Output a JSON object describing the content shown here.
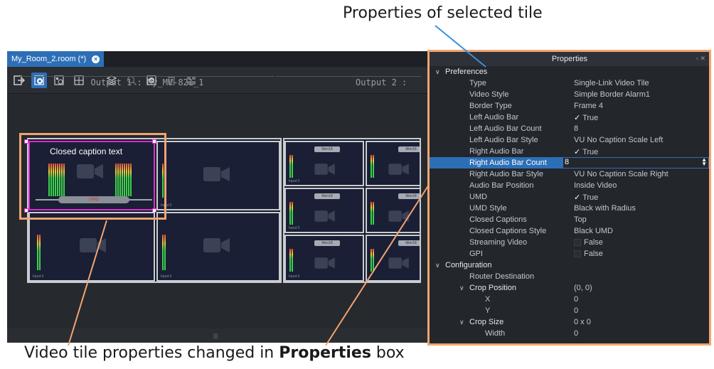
{
  "callouts": {
    "top": "Properties of selected tile",
    "bottom_pre": "Video tile properties changed in ",
    "bottom_bold": "Properties",
    "bottom_post": " box"
  },
  "editor": {
    "tab_label": "My_Room_2.room (*)",
    "toolbar_icons": [
      "exit-icon",
      "add-tile-icon",
      "add-router-icon",
      "grid-icon",
      "layers-icon",
      "zoom-icon",
      "add-icon",
      "delete-icon",
      "layout-icon"
    ],
    "output1_title": "Output 1 : My_MV-821_1",
    "output2_title": "Output 2 :",
    "selected_tile": {
      "caption": "Closed caption text",
      "umd": "UMD"
    },
    "tile_input_label": "Input 0",
    "monitor_label": "Mon18",
    "scroll_grip": "|||"
  },
  "properties": {
    "title": "Properties",
    "rows": [
      {
        "key": "Preferences",
        "value": "",
        "group": true,
        "indent": 0
      },
      {
        "key": "Type",
        "value": "Single-Link Video Tile",
        "indent": 1
      },
      {
        "key": "Video Style",
        "value": "Simple Border Alarm1",
        "indent": 1
      },
      {
        "key": "Border Type",
        "value": "Frame 4",
        "indent": 1
      },
      {
        "key": "Left Audio Bar",
        "value": "True",
        "check": "on",
        "indent": 1
      },
      {
        "key": "Left Audio Bar Count",
        "value": "8",
        "indent": 1
      },
      {
        "key": "Left Audio Bar Style",
        "value": "VU No Caption Scale Left",
        "indent": 1
      },
      {
        "key": "Right Audio Bar",
        "value": "True",
        "check": "on",
        "indent": 1
      },
      {
        "key": "Right Audio Bar Count",
        "value": "8",
        "selected": true,
        "indent": 1
      },
      {
        "key": "Right Audio Bar Style",
        "value": "VU No Caption Scale Right",
        "indent": 1
      },
      {
        "key": "Audio Bar Position",
        "value": "Inside Video",
        "indent": 1
      },
      {
        "key": "UMD",
        "value": "True",
        "check": "on",
        "indent": 1
      },
      {
        "key": "UMD Style",
        "value": "Black with Radius",
        "indent": 1
      },
      {
        "key": "Closed Captions",
        "value": "Top",
        "indent": 1
      },
      {
        "key": "Closed Captions Style",
        "value": "Black UMD",
        "indent": 1
      },
      {
        "key": "Streaming Video",
        "value": "False",
        "check": "off",
        "indent": 1
      },
      {
        "key": "GPI",
        "value": "False",
        "check": "off",
        "indent": 1
      },
      {
        "key": "Configuration",
        "value": "",
        "group": true,
        "indent": 0
      },
      {
        "key": "Router Destination",
        "value": "",
        "indent": 1
      },
      {
        "key": "Crop Position",
        "value": "(0, 0)",
        "group": true,
        "indent": 1
      },
      {
        "key": "X",
        "value": "0",
        "indent": 2
      },
      {
        "key": "Y",
        "value": "0",
        "indent": 2
      },
      {
        "key": "Crop Size",
        "value": "0 x 0",
        "group": true,
        "indent": 1
      },
      {
        "key": "Width",
        "value": "0",
        "indent": 2
      }
    ]
  },
  "colors": {
    "accent": "#2d6fb7",
    "selection_handle": "#e02bd4",
    "callout_box": "#f2a470",
    "callout_line_top": "#3a8fdc"
  }
}
